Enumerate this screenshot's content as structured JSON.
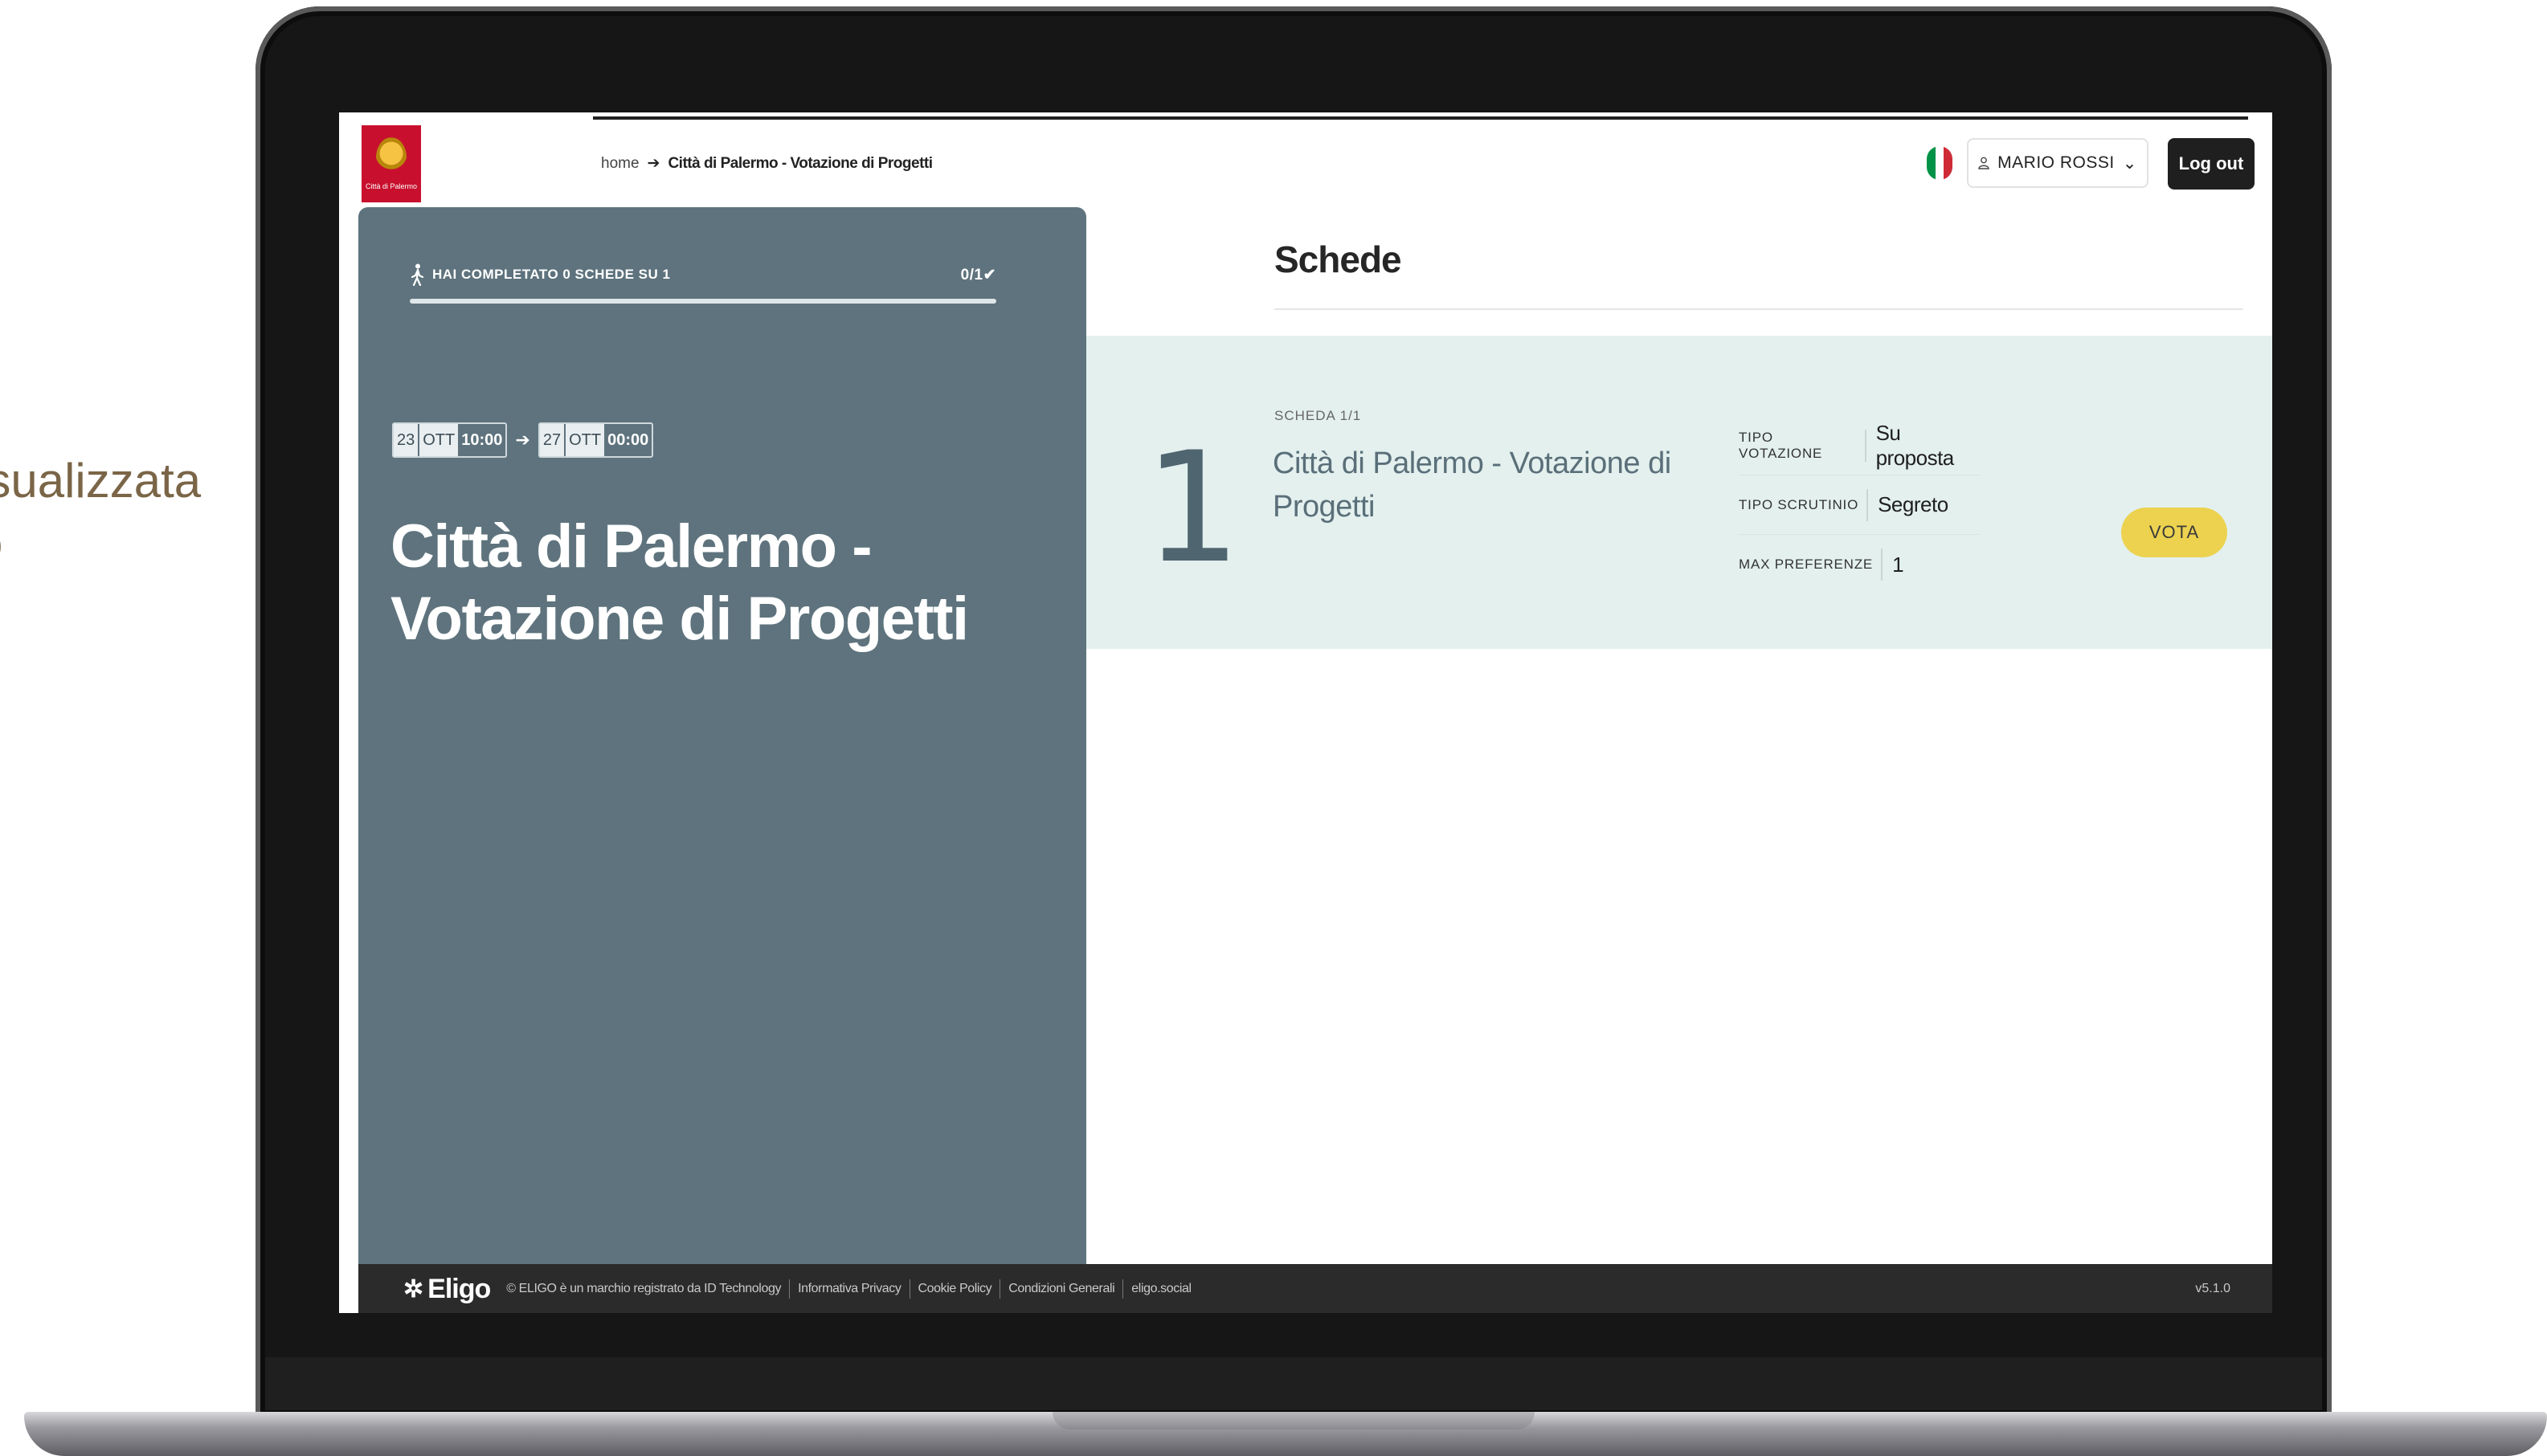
{
  "slide": {
    "caption_line1": "isualizzata",
    "caption_line2": "o"
  },
  "header": {
    "logo_text": "Città di Palermo",
    "breadcrumb": {
      "home": "home",
      "arrow": "➔",
      "current": "Città di Palermo - Votazione di Progetti"
    },
    "user_label": "MARIO ROSSI",
    "user_icon": "user-icon",
    "chevron": "⌄",
    "logout_label": "Log out",
    "flag_colors": [
      "#009246",
      "#ffffff",
      "#ce2b37"
    ]
  },
  "left_panel": {
    "progress_label": "HAI COMPLETATO 0 SCHEDE SU 1",
    "progress_count": "0/1✔",
    "progress_fraction": 0,
    "start": {
      "day": "23",
      "month": "OTT",
      "time": "10:00"
    },
    "date_arrow": "➔",
    "end": {
      "day": "27",
      "month": "OTT",
      "time": "00:00"
    },
    "title": "Città di Palermo - Votazione di Progetti",
    "color": "#5e737d"
  },
  "main": {
    "title": "Schede",
    "card": {
      "number": "1",
      "subtitle": "SCHEDA 1/1",
      "title": "Città di Palermo - Votazione di Progetti",
      "meta": [
        {
          "label": "TIPO VOTAZIONE",
          "value": "Su proposta"
        },
        {
          "label": "TIPO SCRUTINIO",
          "value": "Segreto"
        },
        {
          "label": "MAX PREFERENZE",
          "value": "1"
        }
      ],
      "vote_label": "VOTA",
      "bg_color": "#e3f0ee",
      "button_color": "#ecd24f"
    }
  },
  "footer": {
    "brand": "Eligo",
    "copyright": "© ELIGO è un marchio registrato da ID Technology",
    "links": [
      "Informativa Privacy",
      "Cookie Policy",
      "Condizioni Generali",
      "eligo.social"
    ],
    "version": "v5.1.0"
  }
}
